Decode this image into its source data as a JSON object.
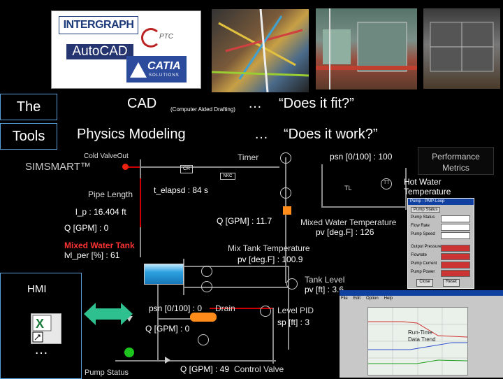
{
  "logos": {
    "intergraph": "INTERGRAPH",
    "ptc": "PTC",
    "autocad": "AutoCAD",
    "catia": "CATIA",
    "catia_sub": "SOLUTIONS"
  },
  "headings": {
    "the": "The",
    "tools": "Tools",
    "cad": "CAD",
    "cad_note": "(Computer Aided Drafting)",
    "cad_ellipsis": "…",
    "cad_question": "“Does it fit?”",
    "physics": "Physics Modeling",
    "physics_ellipsis": "…",
    "physics_question": "“Does it work?”"
  },
  "simsmart": "SIMSMART™",
  "performance": {
    "line1": "Performance",
    "line2": "Metrics"
  },
  "diagram": {
    "cold_valve_out": "Cold ValveOut",
    "cr": "CR",
    "timer": "Timer",
    "nkc": "NKC",
    "psn_top": "psn [0/100] : 100",
    "tt": "TT",
    "tl": "TL",
    "hot_water_temp1": "Hot Water",
    "hot_water_temp2": "Temperature",
    "pipe_length": "Pipe Length",
    "t_elapsd": "t_elapsd : 84 s",
    "l_p": "l_p : 16.404 ft",
    "q_gpm_0": "Q [GPM] : 0",
    "q_gpm_117": "Q [GPM] : 11.7",
    "mixed_water_temp": "Mixed Water Temperature",
    "pv_126": "pv [deg.F] : 126",
    "mixed_water_tank": "Mixed Water Tank",
    "lvl_per": "lvl_per [%] : 61",
    "mix_tank_temp": "Mix Tank Temperature",
    "pv_1009": "pv [deg.F] : 100.9",
    "tank_level": "Tank Level",
    "pv_ft": "pv [ft] : 3.6",
    "psn_bottom": "psn [0/100] : 0",
    "drain": "Drain",
    "level_pid": "Level PID",
    "sp_ft": "sp [ft] : 3",
    "q_gpm_0b": "Q [GPM] : 0",
    "q_gpm_49": "Q [GPM] : 49",
    "control_valve": "Control Valve",
    "pump_status": "Pump Status"
  },
  "dialog": {
    "title": "Pump - PMP-Loop",
    "tab": "Pump Status",
    "rows": [
      "Pump Status",
      "Flow Rate",
      "Pump Speed",
      "Output Pressure",
      "Flowrate",
      "Pump Current",
      "Pump Power"
    ],
    "buttons": [
      "Close",
      "Reset"
    ]
  },
  "trend": {
    "menu": [
      "File",
      "Edit",
      "Option",
      "Help"
    ],
    "label1": "Run-Time",
    "label2": "Data Trend"
  },
  "hmi": {
    "label": "HMI",
    "ellipsis": "…"
  },
  "colors": {
    "accent_border": "#5aa0d8",
    "alarm_red": "#ff3333",
    "pipe_orange": "#ff8c1a",
    "pump_green": "#1dc41d"
  }
}
